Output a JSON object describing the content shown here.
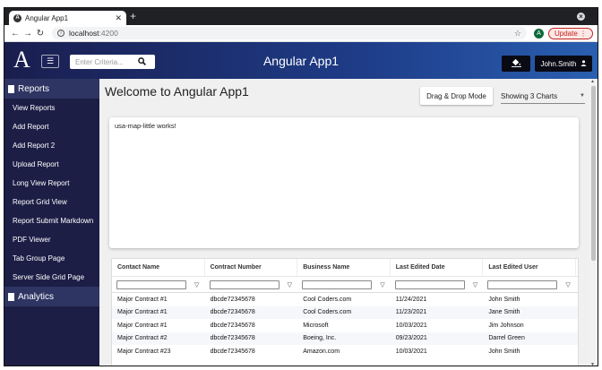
{
  "browser": {
    "tab_title": "Angular App1",
    "favicon_letter": "A",
    "url_host": "localhost",
    "url_port": ":4200",
    "profile_letter": "A",
    "update_label": "Update"
  },
  "header": {
    "logo": "A",
    "search_placeholder": "Enter Criteria...",
    "app_title": "Angular App1",
    "user_name": "John.Smith"
  },
  "sidebar": {
    "reports_label": "Reports",
    "items": [
      {
        "label": "View Reports"
      },
      {
        "label": "Add Report"
      },
      {
        "label": "Add Report 2"
      },
      {
        "label": "Upload Report"
      },
      {
        "label": "Long View Report"
      },
      {
        "label": "Report Grid View"
      },
      {
        "label": "Report Submit Markdown"
      },
      {
        "label": "PDF Viewer"
      },
      {
        "label": "Tab Group Page"
      },
      {
        "label": "Server Side Grid Page"
      }
    ],
    "analytics_label": "Analytics"
  },
  "main": {
    "welcome": "Welcome to Angular App1",
    "drag_drop_label": "Drag & Drop Mode",
    "charts_selected": "Showing 3 Charts",
    "card_message": "usa-map-little works!"
  },
  "grid": {
    "columns": [
      "Contact Name",
      "Contract Number",
      "Business Name",
      "Last Edited Date",
      "Last Edited User"
    ],
    "rows": [
      [
        "Major Contract #1",
        "dbcde72345678",
        "Cool Coders.com",
        "11/24/2021",
        "John Smith"
      ],
      [
        "Major Contract #1",
        "dbcde72345678",
        "Cool Coders.com",
        "11/23/2021",
        "Jane Smith"
      ],
      [
        "Major Contract #1",
        "dbcde72345678",
        "Microsoft",
        "10/03/2021",
        "Jim Johnson"
      ],
      [
        "Major Contract #2",
        "dbcde72345678",
        "Boeing, Inc.",
        "09/23/2021",
        "Darrel Green"
      ],
      [
        "Major Contract #23",
        "dbcde72345678",
        "Amazon.com",
        "10/03/2021",
        "John Smith"
      ]
    ]
  },
  "colors": {
    "sidebar_bg": "#1c1e46",
    "sidebar_section": "#2e3563",
    "header_start": "#1a1e4e",
    "header_end": "#2a5fb0",
    "update_accent": "#c5221f"
  },
  "icons": {
    "menu": "hamburger-icon",
    "search": "search-icon",
    "paint": "paint-bucket-icon",
    "user": "user-icon",
    "filter": "filter-icon"
  }
}
